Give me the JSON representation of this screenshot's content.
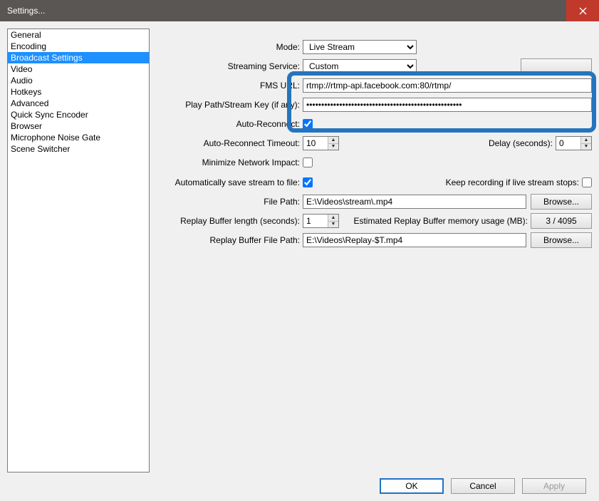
{
  "window": {
    "title": "Settings..."
  },
  "sidebar": [
    "General",
    "Encoding",
    "Broadcast Settings",
    "Video",
    "Audio",
    "Hotkeys",
    "Advanced",
    "Quick Sync Encoder",
    "Browser",
    "Microphone Noise Gate",
    "Scene Switcher"
  ],
  "form": {
    "mode": {
      "label": "Mode:",
      "value": "Live Stream"
    },
    "service": {
      "label": "Streaming Service:",
      "value": "Custom"
    },
    "fms": {
      "label": "FMS URL:",
      "value": "rtmp://rtmp-api.facebook.com:80/rtmp/"
    },
    "key": {
      "label": "Play Path/Stream Key (if any):",
      "value": "****************************************************"
    },
    "autoreconnect": {
      "label": "Auto-Reconnect:"
    },
    "timeout": {
      "label": "Auto-Reconnect Timeout:",
      "value": "10"
    },
    "delay": {
      "label": "Delay (seconds):",
      "value": "0"
    },
    "minimize": {
      "label": "Minimize Network Impact:"
    },
    "autosave": {
      "label": "Automatically save stream to file:"
    },
    "keeprec": {
      "label": "Keep recording if live stream stops:"
    },
    "filepath": {
      "label": "File Path:",
      "value": "E:\\Videos\\stream\\.mp4"
    },
    "replaylen": {
      "label": "Replay Buffer length (seconds):",
      "value": "1"
    },
    "replaymem": {
      "label": "Estimated Replay Buffer memory usage (MB):",
      "value": "3 / 4095"
    },
    "replaypath": {
      "label": "Replay Buffer File Path:",
      "value": "E:\\Videos\\Replay-$T.mp4"
    },
    "browse": "Browse..."
  },
  "buttons": {
    "ok": "OK",
    "cancel": "Cancel",
    "apply": "Apply"
  }
}
